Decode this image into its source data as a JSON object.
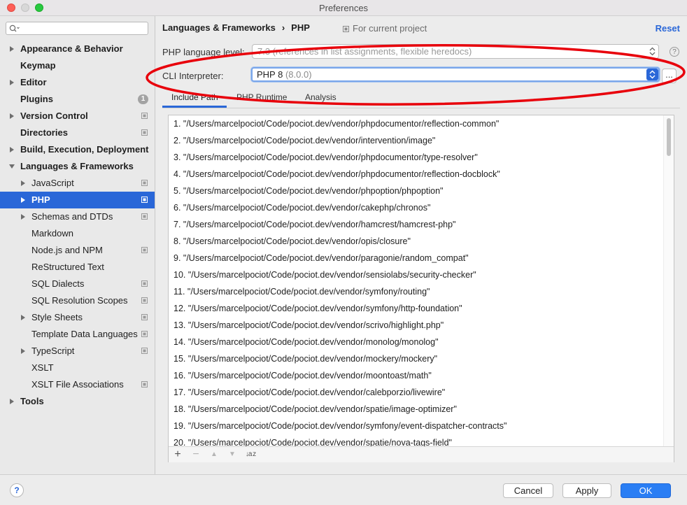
{
  "window": {
    "title": "Preferences"
  },
  "sidebar": {
    "search_placeholder": "",
    "items": [
      {
        "label": "Appearance & Behavior",
        "level": 0,
        "arrow": "right",
        "bold": true,
        "icon": "",
        "badge": ""
      },
      {
        "label": "Keymap",
        "level": 0,
        "arrow": "",
        "bold": true,
        "icon": "",
        "badge": ""
      },
      {
        "label": "Editor",
        "level": 0,
        "arrow": "right",
        "bold": true,
        "icon": "",
        "badge": ""
      },
      {
        "label": "Plugins",
        "level": 0,
        "arrow": "",
        "bold": true,
        "icon": "",
        "badge": "1"
      },
      {
        "label": "Version Control",
        "level": 0,
        "arrow": "right",
        "bold": true,
        "icon": "project-icon",
        "badge": ""
      },
      {
        "label": "Directories",
        "level": 0,
        "arrow": "",
        "bold": true,
        "icon": "project-icon",
        "badge": ""
      },
      {
        "label": "Build, Execution, Deployment",
        "level": 0,
        "arrow": "right",
        "bold": true,
        "icon": "",
        "badge": ""
      },
      {
        "label": "Languages & Frameworks",
        "level": 0,
        "arrow": "down",
        "bold": true,
        "icon": "",
        "badge": ""
      },
      {
        "label": "JavaScript",
        "level": 1,
        "arrow": "right",
        "bold": false,
        "icon": "project-icon",
        "badge": ""
      },
      {
        "label": "PHP",
        "level": 1,
        "arrow": "right",
        "bold": true,
        "icon": "project-icon",
        "badge": "",
        "selected": true
      },
      {
        "label": "Schemas and DTDs",
        "level": 1,
        "arrow": "right",
        "bold": false,
        "icon": "project-icon",
        "badge": ""
      },
      {
        "label": "Markdown",
        "level": 1,
        "arrow": "",
        "bold": false,
        "icon": "",
        "badge": ""
      },
      {
        "label": "Node.js and NPM",
        "level": 1,
        "arrow": "",
        "bold": false,
        "icon": "project-icon",
        "badge": ""
      },
      {
        "label": "ReStructured Text",
        "level": 1,
        "arrow": "",
        "bold": false,
        "icon": "",
        "badge": ""
      },
      {
        "label": "SQL Dialects",
        "level": 1,
        "arrow": "",
        "bold": false,
        "icon": "project-icon",
        "badge": ""
      },
      {
        "label": "SQL Resolution Scopes",
        "level": 1,
        "arrow": "",
        "bold": false,
        "icon": "project-icon",
        "badge": ""
      },
      {
        "label": "Style Sheets",
        "level": 1,
        "arrow": "right",
        "bold": false,
        "icon": "project-icon",
        "badge": ""
      },
      {
        "label": "Template Data Languages",
        "level": 1,
        "arrow": "",
        "bold": false,
        "icon": "project-icon",
        "badge": ""
      },
      {
        "label": "TypeScript",
        "level": 1,
        "arrow": "right",
        "bold": false,
        "icon": "project-icon",
        "badge": ""
      },
      {
        "label": "XSLT",
        "level": 1,
        "arrow": "",
        "bold": false,
        "icon": "",
        "badge": ""
      },
      {
        "label": "XSLT File Associations",
        "level": 1,
        "arrow": "",
        "bold": false,
        "icon": "project-icon",
        "badge": ""
      },
      {
        "label": "Tools",
        "level": 0,
        "arrow": "right",
        "bold": true,
        "icon": "",
        "badge": ""
      }
    ]
  },
  "header": {
    "breadcrumb_parent": "Languages & Frameworks",
    "breadcrumb_separator": "›",
    "breadcrumb_current": "PHP",
    "scope_label": "For current project",
    "reset_label": "Reset"
  },
  "form": {
    "language_level_label": "PHP language level:",
    "language_level_value": "7.3 (references in list assignments, flexible heredocs)",
    "help_glyph": "?",
    "cli_label": "CLI Interpreter:",
    "cli_value": "PHP 8",
    "cli_version": "(8.0.0)",
    "cli_browse_label": "..."
  },
  "tabs": [
    {
      "label": "Include Path",
      "active": true
    },
    {
      "label": "PHP Runtime",
      "active": false
    },
    {
      "label": "Analysis",
      "active": false
    }
  ],
  "include_paths": [
    "1. \"/Users/marcelpociot/Code/pociot.dev/vendor/phpdocumentor/reflection-common\"",
    "2. \"/Users/marcelpociot/Code/pociot.dev/vendor/intervention/image\"",
    "3. \"/Users/marcelpociot/Code/pociot.dev/vendor/phpdocumentor/type-resolver\"",
    "4. \"/Users/marcelpociot/Code/pociot.dev/vendor/phpdocumentor/reflection-docblock\"",
    "5. \"/Users/marcelpociot/Code/pociot.dev/vendor/phpoption/phpoption\"",
    "6. \"/Users/marcelpociot/Code/pociot.dev/vendor/cakephp/chronos\"",
    "7. \"/Users/marcelpociot/Code/pociot.dev/vendor/hamcrest/hamcrest-php\"",
    "8. \"/Users/marcelpociot/Code/pociot.dev/vendor/opis/closure\"",
    "9. \"/Users/marcelpociot/Code/pociot.dev/vendor/paragonie/random_compat\"",
    "10. \"/Users/marcelpociot/Code/pociot.dev/vendor/sensiolabs/security-checker\"",
    "11. \"/Users/marcelpociot/Code/pociot.dev/vendor/symfony/routing\"",
    "12. \"/Users/marcelpociot/Code/pociot.dev/vendor/symfony/http-foundation\"",
    "13. \"/Users/marcelpociot/Code/pociot.dev/vendor/scrivo/highlight.php\"",
    "14. \"/Users/marcelpociot/Code/pociot.dev/vendor/monolog/monolog\"",
    "15. \"/Users/marcelpociot/Code/pociot.dev/vendor/mockery/mockery\"",
    "16. \"/Users/marcelpociot/Code/pociot.dev/vendor/moontoast/math\"",
    "17. \"/Users/marcelpociot/Code/pociot.dev/vendor/calebporzio/livewire\"",
    "18. \"/Users/marcelpociot/Code/pociot.dev/vendor/spatie/image-optimizer\"",
    "19. \"/Users/marcelpociot/Code/pociot.dev/vendor/symfony/event-dispatcher-contracts\"",
    "20. \"/Users/marcelpociot/Code/pociot.dev/vendor/spatie/nova-tags-field\""
  ],
  "list_toolbar": {
    "add_glyph": "+",
    "remove_glyph": "−",
    "up_glyph": "▲",
    "down_glyph": "▼",
    "sort_glyph": "↓a z"
  },
  "footer": {
    "help_glyph": "?",
    "cancel_label": "Cancel",
    "apply_label": "Apply",
    "ok_label": "OK"
  },
  "colors": {
    "accent": "#2a67d8",
    "annotation": "#e8000b"
  }
}
